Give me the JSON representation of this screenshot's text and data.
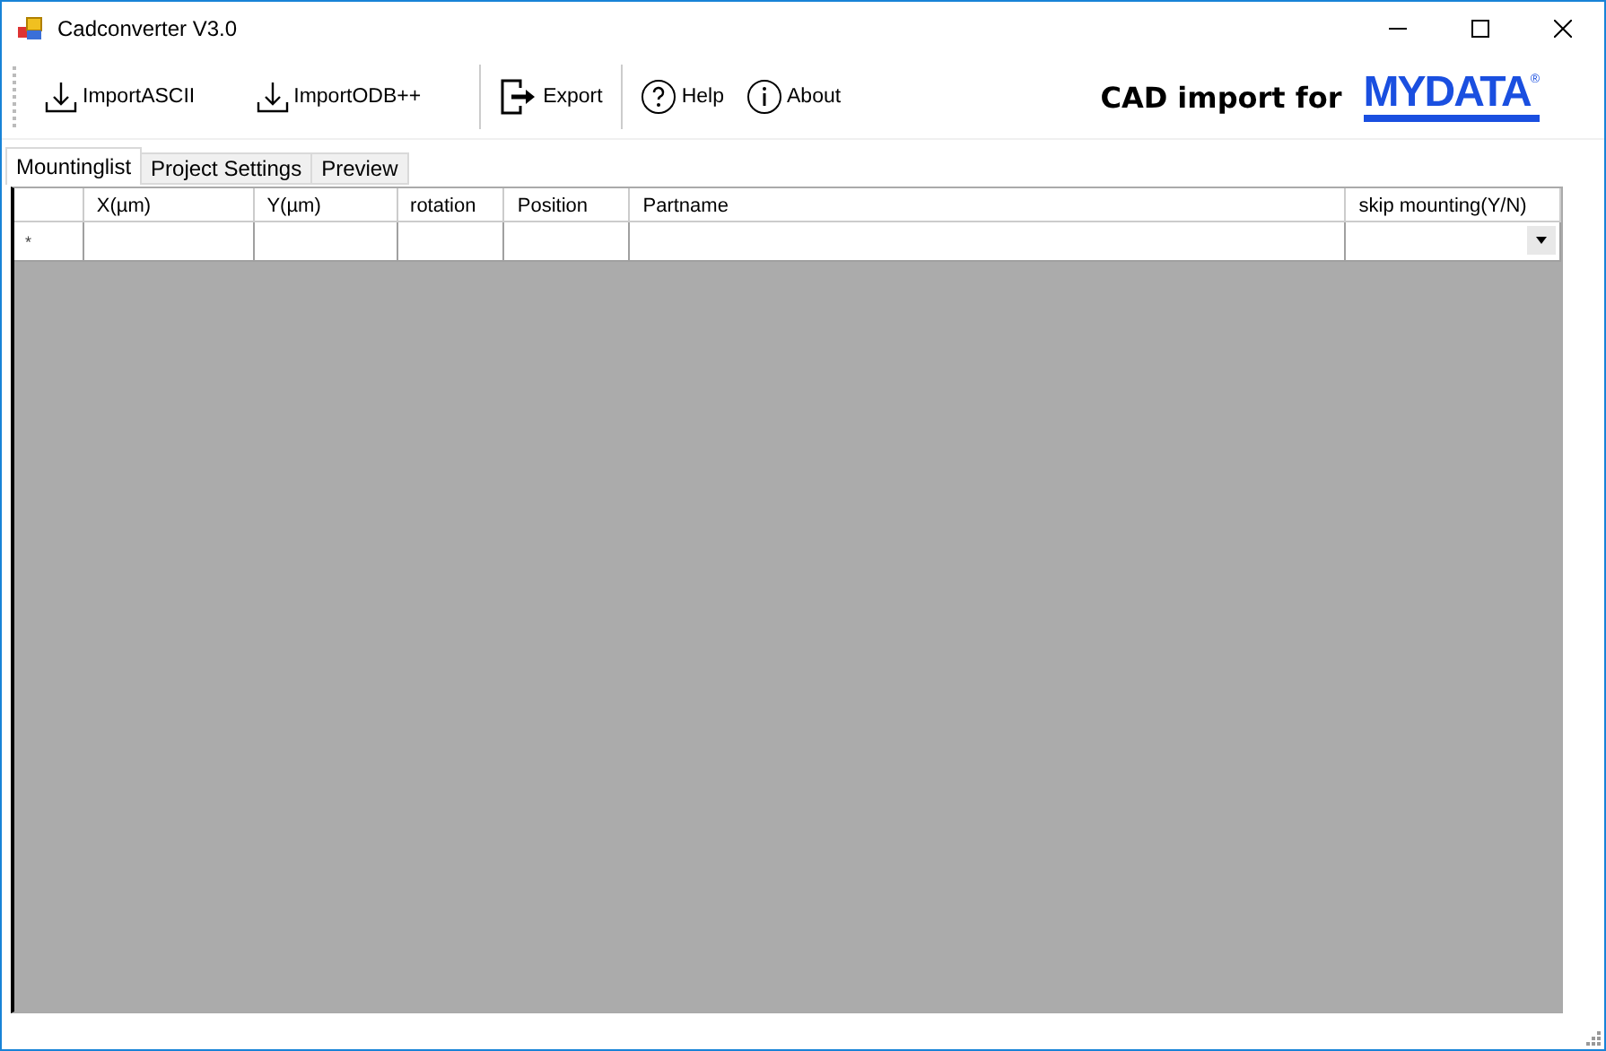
{
  "window": {
    "title": "Cadconverter V3.0"
  },
  "toolbar": [
    {
      "kind": "import",
      "label": "ImportASCII"
    },
    {
      "kind": "import",
      "label": "ImportODB++"
    },
    {
      "kind": "separator"
    },
    {
      "kind": "export",
      "label": "Export"
    },
    {
      "kind": "separator"
    },
    {
      "kind": "help",
      "label": "Help"
    },
    {
      "kind": "about",
      "label": "About"
    }
  ],
  "brand": {
    "caption": "CAD import for",
    "logo": "MYDATA",
    "logo_mark": "®"
  },
  "tabs": [
    {
      "label": "Mountinglist",
      "selected": true
    },
    {
      "label": "Project Settings",
      "selected": false
    },
    {
      "label": "Preview",
      "selected": false
    }
  ],
  "table": {
    "columns": [
      "X(µm)",
      "Y(µm)",
      "rotation",
      "Position",
      "Partname",
      "skip mounting(Y/N)"
    ],
    "new_row_marker": "*"
  }
}
